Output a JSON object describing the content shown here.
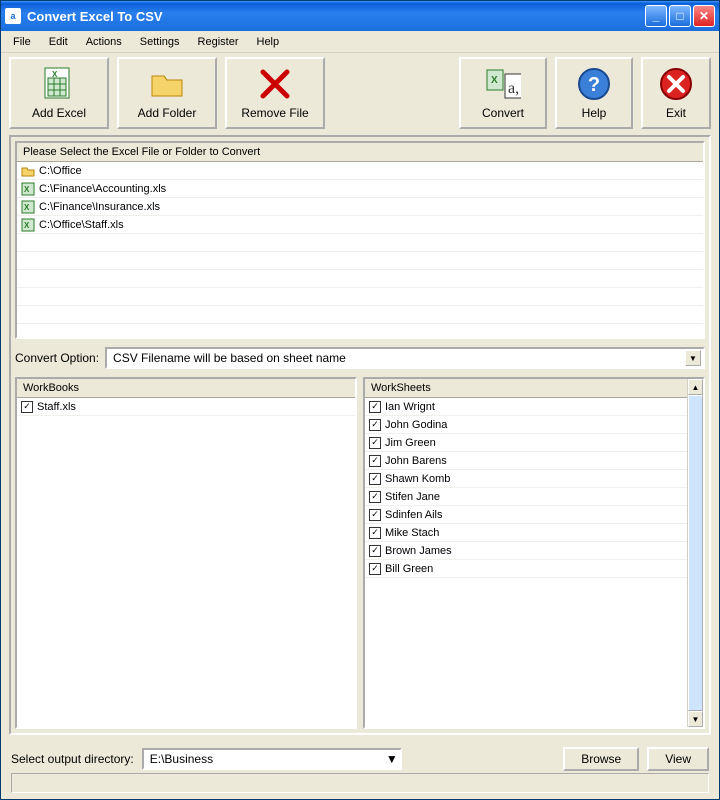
{
  "window": {
    "title": "Convert Excel To CSV"
  },
  "menu": [
    "File",
    "Edit",
    "Actions",
    "Settings",
    "Register",
    "Help"
  ],
  "toolbar": {
    "add_excel": "Add Excel",
    "add_folder": "Add Folder",
    "remove_file": "Remove File",
    "convert": "Convert",
    "help": "Help",
    "exit": "Exit"
  },
  "filelist": {
    "header": "Please Select the Excel File or Folder to Convert",
    "items": [
      {
        "type": "folder",
        "path": "C:\\Office"
      },
      {
        "type": "xls",
        "path": "C:\\Finance\\Accounting.xls"
      },
      {
        "type": "xls",
        "path": "C:\\Finance\\Insurance.xls"
      },
      {
        "type": "xls",
        "path": "C:\\Office\\Staff.xls"
      }
    ]
  },
  "convert_option": {
    "label": "Convert Option:",
    "value": "CSV Filename will be based on sheet name"
  },
  "workbooks": {
    "header": "WorkBooks",
    "items": [
      {
        "name": "Staff.xls",
        "checked": true
      }
    ]
  },
  "worksheets": {
    "header": "WorkSheets",
    "items": [
      {
        "name": "Ian Wrignt",
        "checked": true
      },
      {
        "name": "John Godina",
        "checked": true
      },
      {
        "name": "Jim Green",
        "checked": true
      },
      {
        "name": "John Barens",
        "checked": true
      },
      {
        "name": "Shawn Komb",
        "checked": true
      },
      {
        "name": "Stifen Jane",
        "checked": true
      },
      {
        "name": "Sdinfen Ails",
        "checked": true
      },
      {
        "name": "Mike Stach",
        "checked": true
      },
      {
        "name": "Brown James",
        "checked": true
      },
      {
        "name": "Bill Green",
        "checked": true
      }
    ]
  },
  "output": {
    "label": "Select  output directory:",
    "value": "E:\\Business",
    "browse": "Browse",
    "view": "View"
  }
}
